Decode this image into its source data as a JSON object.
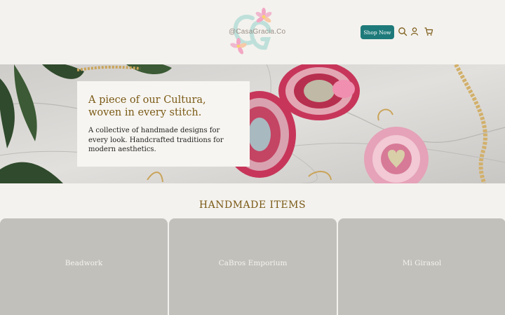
{
  "header": {
    "logo_text": "@CasaGracia.Co",
    "shop_button": "Shop Now",
    "icons": [
      "search-icon",
      "account-icon",
      "cart-icon"
    ]
  },
  "hero": {
    "title": "A piece of our Cultura, woven in every stitch.",
    "text": "A collective of handmade designs for every look. Handcrafted traditions for modern aesthetics."
  },
  "section": {
    "title": "HANDMADE ITEMS",
    "cards": [
      {
        "label": "Beadwork"
      },
      {
        "label": "CaBros Emporium"
      },
      {
        "label": "Mi Girasol"
      }
    ]
  },
  "colors": {
    "background": "#f4f2ee",
    "accent_teal": "#1e7a7a",
    "accent_gold": "#7a5a16",
    "card_gray": "#c2c0bb"
  }
}
